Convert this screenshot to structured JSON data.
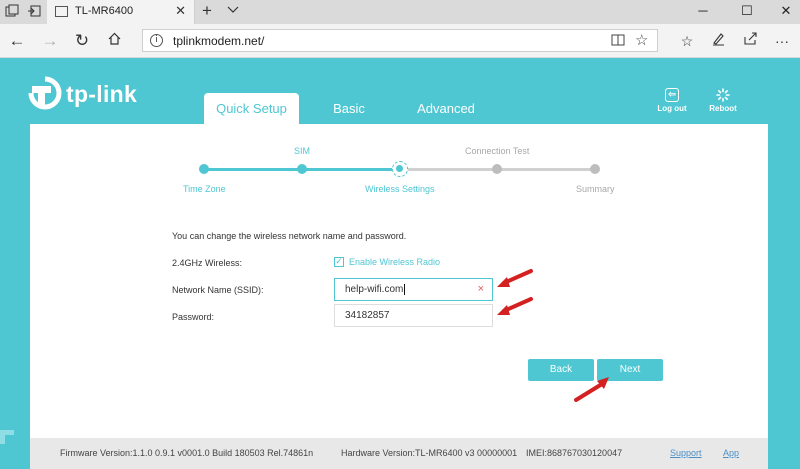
{
  "browser": {
    "tab_title": "TL-MR6400",
    "url": "tplinkmodem.net/",
    "icons": {
      "tab_actions": "tab-actions-icon",
      "set_aside": "set-aside-icon",
      "new_tab": "plus-icon",
      "tab_list": "chevron-down-icon",
      "back": "back-arrow-icon",
      "forward": "forward-arrow-icon",
      "refresh": "refresh-icon",
      "home": "home-icon",
      "info": "info-icon",
      "reading_view": "book-icon",
      "favorite": "star-icon",
      "hub": "hub-icon",
      "notes": "pen-icon",
      "share": "share-icon",
      "more": "more-icon"
    }
  },
  "app": {
    "brand": "tp-link",
    "tabs": [
      "Quick Setup",
      "Basic",
      "Advanced"
    ],
    "active_tab": 0,
    "actions": {
      "logout": "Log out",
      "reboot": "Reboot"
    },
    "accent_color": "#4ec7d3"
  },
  "wizard": {
    "steps": [
      {
        "label": "Time Zone",
        "state": "done"
      },
      {
        "label": "SIM",
        "state": "done"
      },
      {
        "label": "Wireless Settings",
        "state": "current"
      },
      {
        "label": "Connection Test",
        "state": "todo"
      },
      {
        "label": "Summary",
        "state": "todo"
      }
    ]
  },
  "form": {
    "intro": "You can change the wireless network name and password.",
    "wireless_label": "2.4GHz Wireless:",
    "enable_radio_label": "Enable Wireless Radio",
    "enable_radio_checked": true,
    "ssid_label": "Network Name (SSID):",
    "ssid_value": "help-wifi.com",
    "password_label": "Password:",
    "password_value": "34182857"
  },
  "buttons": {
    "back": "Back",
    "next": "Next"
  },
  "footer": {
    "firmware": "Firmware Version:1.1.0 0.9.1 v0001.0 Build 180503 Rel.74861n",
    "hardware": "Hardware Version:TL-MR6400 v3 00000001",
    "imei": "IMEI:868767030120047",
    "support": "Support",
    "app": "App"
  }
}
